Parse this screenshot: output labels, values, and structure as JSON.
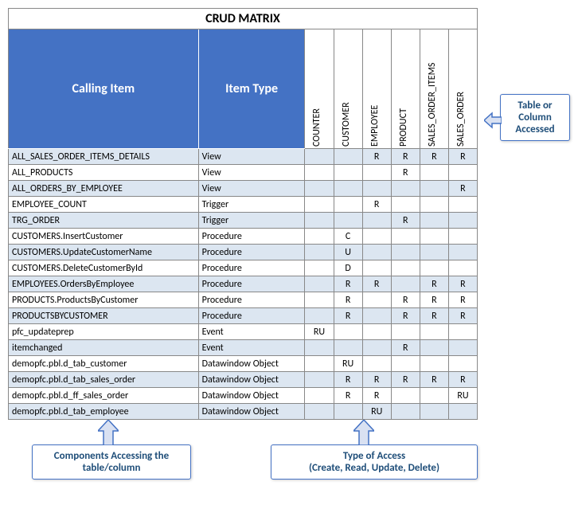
{
  "title": "CRUD MATRIX",
  "callingHeader": "Calling Item",
  "typeHeader": "Item Type",
  "columns": [
    "COUNTER",
    "CUSTOMER",
    "EMPLOYEE",
    "PRODUCT",
    "SALES_ORDER_ITEMS",
    "SALES_ORDER"
  ],
  "rows": [
    {
      "name": "ALL_SALES_ORDER_ITEMS_DETAILS",
      "type": "View",
      "cells": [
        "",
        "",
        "R",
        "R",
        "R",
        "R"
      ]
    },
    {
      "name": "ALL_PRODUCTS",
      "type": "View",
      "cells": [
        "",
        "",
        "",
        "R",
        "",
        ""
      ]
    },
    {
      "name": "ALL_ORDERS_BY_EMPLOYEE",
      "type": "View",
      "cells": [
        "",
        "",
        "",
        "",
        "",
        "R"
      ]
    },
    {
      "name": "EMPLOYEE_COUNT",
      "type": "Trigger",
      "cells": [
        "",
        "",
        "R",
        "",
        "",
        ""
      ]
    },
    {
      "name": "TRG_ORDER",
      "type": "Trigger",
      "cells": [
        "",
        "",
        "",
        "R",
        "",
        ""
      ]
    },
    {
      "name": "CUSTOMERS.InsertCustomer",
      "type": "Procedure",
      "cells": [
        "",
        "C",
        "",
        "",
        "",
        ""
      ]
    },
    {
      "name": "CUSTOMERS.UpdateCustomerName",
      "type": "Procedure",
      "cells": [
        "",
        "U",
        "",
        "",
        "",
        ""
      ]
    },
    {
      "name": "CUSTOMERS.DeleteCustomerById",
      "type": "Procedure",
      "cells": [
        "",
        "D",
        "",
        "",
        "",
        ""
      ]
    },
    {
      "name": "EMPLOYEES.OrdersByEmployee",
      "type": "Procedure",
      "cells": [
        "",
        "R",
        "R",
        "",
        "R",
        "R"
      ]
    },
    {
      "name": "PRODUCTS.ProductsByCustomer",
      "type": "Procedure",
      "cells": [
        "",
        "R",
        "",
        "R",
        "R",
        "R"
      ]
    },
    {
      "name": "PRODUCTSBYCUSTOMER",
      "type": "Procedure",
      "cells": [
        "",
        "R",
        "",
        "R",
        "R",
        "R"
      ]
    },
    {
      "name": "pfc_updateprep",
      "type": "Event",
      "cells": [
        "RU",
        "",
        "",
        "",
        "",
        ""
      ]
    },
    {
      "name": "itemchanged",
      "type": "Event",
      "cells": [
        "",
        "",
        "",
        "R",
        "",
        ""
      ]
    },
    {
      "name": "demopfc.pbl.d_tab_customer",
      "type": "Datawindow Object",
      "cells": [
        "",
        "RU",
        "",
        "",
        "",
        ""
      ]
    },
    {
      "name": "demopfc.pbl.d_tab_sales_order",
      "type": "Datawindow Object",
      "cells": [
        "",
        "R",
        "R",
        "R",
        "R",
        "R"
      ]
    },
    {
      "name": "demopfc.pbl.d_ff_sales_order",
      "type": "Datawindow Object",
      "cells": [
        "",
        "R",
        "R",
        "",
        "",
        "RU"
      ]
    },
    {
      "name": "demopfc.pbl.d_tab_employee",
      "type": "Datawindow Object",
      "cells": [
        "",
        "",
        "RU",
        "",
        "",
        ""
      ]
    }
  ],
  "callouts": {
    "right": "Table or Column Accessed",
    "bottomLeft": "Components Accessing the table/column",
    "bottomRight": "Type of Access\n(Create, Read, Update, Delete)"
  }
}
